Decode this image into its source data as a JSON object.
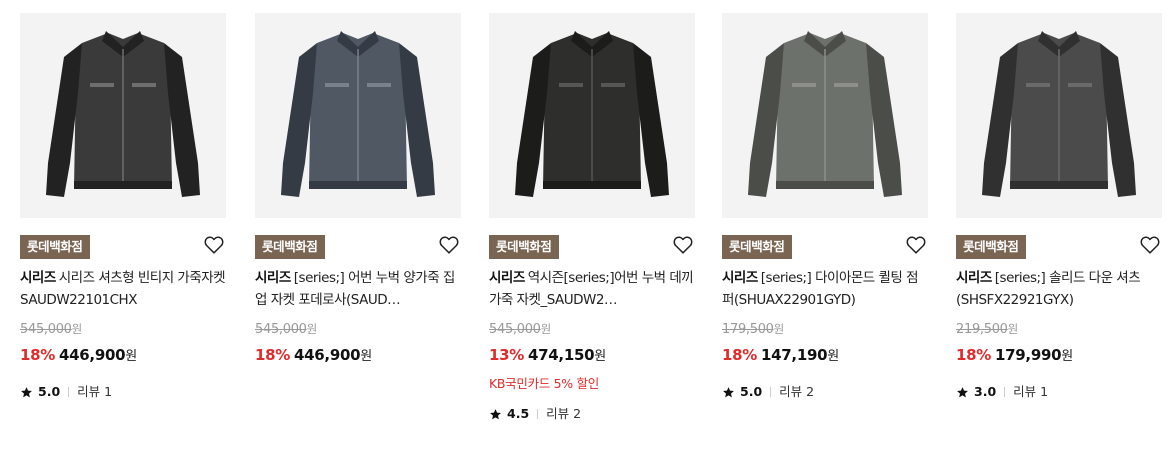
{
  "products": [
    {
      "image": "leather-jacket-photo",
      "shop_badge": "롯데백화점",
      "brand": "시리즈",
      "name": "시리즈 셔츠형 빈티지 가죽자켓 SAUDW22101CHX",
      "original_price": "545,000",
      "discount_rate": "18%",
      "sale_price": "446,900",
      "currency": "원",
      "benefit": "",
      "rating": "5.0",
      "review_label": "리뷰 1",
      "colors": {
        "bg": "#f3f3f3",
        "main": "#3a3a3a",
        "dark": "#222222",
        "light": "#6e6e6e"
      }
    },
    {
      "image": "suede-zip-jacket-photo",
      "shop_badge": "롯데백화점",
      "brand": "시리즈",
      "name": "[series;] 어번 누벅 양가죽 집업 자켓 포데로사(SAUD…",
      "original_price": "545,000",
      "discount_rate": "18%",
      "sale_price": "446,900",
      "currency": "원",
      "benefit": "",
      "rating": "",
      "review_label": "",
      "colors": {
        "bg": "#f3f3f3",
        "main": "#4f5863",
        "dark": "#343b44",
        "light": "#78818c"
      }
    },
    {
      "image": "nubuck-blazer-photo",
      "shop_badge": "롯데백화점",
      "brand": "시리즈",
      "name": "역시즌[series;]어번 누벅 데끼 가죽 자켓_SAUDW2…",
      "original_price": "545,000",
      "discount_rate": "13%",
      "sale_price": "474,150",
      "currency": "원",
      "benefit": "KB국민카드 5% 할인",
      "rating": "4.5",
      "review_label": "리뷰 2",
      "colors": {
        "bg": "#f3f3f3",
        "main": "#2e2e2c",
        "dark": "#1c1c1b",
        "light": "#565653"
      }
    },
    {
      "image": "quilted-jumper-photo",
      "shop_badge": "롯데백화점",
      "brand": "시리즈",
      "name": "[series;] 다이아몬드 퀼팅 점퍼(SHUAX22901GYD)",
      "original_price": "179,500",
      "discount_rate": "18%",
      "sale_price": "147,190",
      "currency": "원",
      "benefit": "",
      "rating": "5.0",
      "review_label": "리뷰 2",
      "colors": {
        "bg": "#f3f3f3",
        "main": "#6d716b",
        "dark": "#4a4d48",
        "light": "#8c9089"
      }
    },
    {
      "image": "down-shirt-jacket-photo",
      "shop_badge": "롯데백화점",
      "brand": "시리즈",
      "name": "[series;] 솔리드 다운 셔츠(SHSFX22921GYX)",
      "original_price": "219,500",
      "discount_rate": "18%",
      "sale_price": "179,990",
      "currency": "원",
      "benefit": "",
      "rating": "3.0",
      "review_label": "리뷰 1",
      "colors": {
        "bg": "#f3f3f3",
        "main": "#4b4b4b",
        "dark": "#303030",
        "light": "#6a6a6a"
      }
    }
  ],
  "theme": {
    "badge_bg": "#7a6553",
    "discount_color": "#e02b2b",
    "icons": {
      "wishlist": "heart-outline-icon",
      "rating": "star-filled-icon"
    }
  }
}
